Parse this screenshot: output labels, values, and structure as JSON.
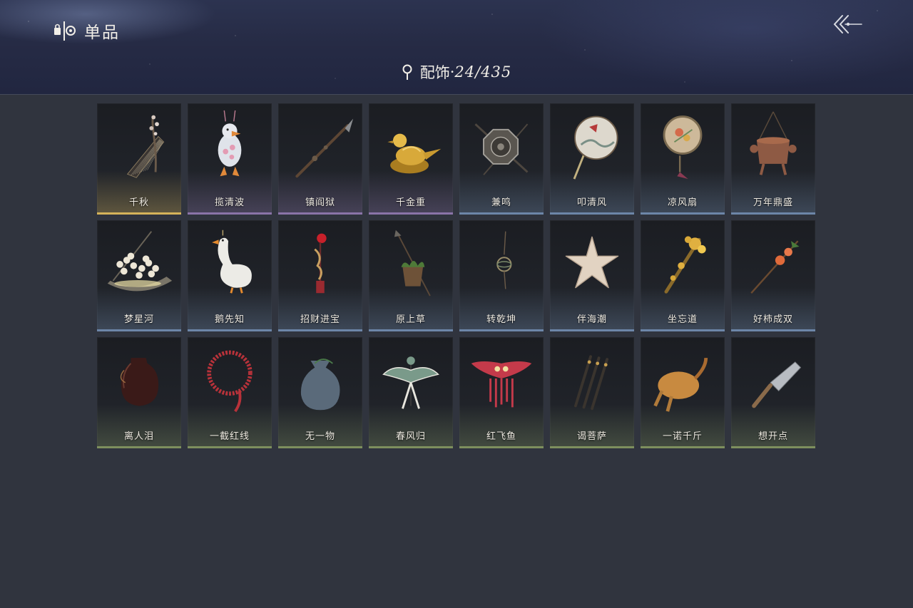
{
  "header": {
    "title": "单品",
    "back_icon": "double-chevron-left-icon"
  },
  "category": {
    "name": "配饰",
    "separator": "·",
    "count": "24/435"
  },
  "colors": {
    "gold": "#d4b25a",
    "purple": "#8a74a8",
    "blue": "#6d86a8",
    "green": "#7e8f5e"
  },
  "items": [
    {
      "name": "千秋",
      "rarity": "gold",
      "icon": "guqin-zither-icon"
    },
    {
      "name": "揽清波",
      "rarity": "purple",
      "icon": "duck-toy-icon"
    },
    {
      "name": "镇阎狱",
      "rarity": "purple",
      "icon": "spear-icon"
    },
    {
      "name": "千金重",
      "rarity": "purple",
      "icon": "golden-pheasant-icon"
    },
    {
      "name": "兼鸣",
      "rarity": "blue",
      "icon": "octagonal-shield-icon"
    },
    {
      "name": "叩清风",
      "rarity": "blue",
      "icon": "round-fan-icon"
    },
    {
      "name": "凉风扇",
      "rarity": "blue",
      "icon": "embroidered-fan-icon"
    },
    {
      "name": "万年鼎盛",
      "rarity": "blue",
      "icon": "tripod-censer-icon"
    },
    {
      "name": "梦星河",
      "rarity": "blue",
      "icon": "flower-basket-icon"
    },
    {
      "name": "鹅先知",
      "rarity": "blue",
      "icon": "goose-icon"
    },
    {
      "name": "招财进宝",
      "rarity": "blue",
      "icon": "tassel-pendant-icon"
    },
    {
      "name": "原上草",
      "rarity": "blue",
      "icon": "herb-basket-icon"
    },
    {
      "name": "转乾坤",
      "rarity": "blue",
      "icon": "armillary-charm-icon"
    },
    {
      "name": "伴海潮",
      "rarity": "blue",
      "icon": "starfish-icon"
    },
    {
      "name": "坐忘道",
      "rarity": "blue",
      "icon": "golden-scepter-icon"
    },
    {
      "name": "好柿成双",
      "rarity": "blue",
      "icon": "persimmon-branch-icon"
    },
    {
      "name": "离人泪",
      "rarity": "green",
      "icon": "wine-jar-icon"
    },
    {
      "name": "一截红线",
      "rarity": "green",
      "icon": "red-cord-icon"
    },
    {
      "name": "无一物",
      "rarity": "green",
      "icon": "cloth-pouch-icon"
    },
    {
      "name": "春风归",
      "rarity": "green",
      "icon": "swallow-kite-icon"
    },
    {
      "name": "红飞鱼",
      "rarity": "green",
      "icon": "fish-kite-icon"
    },
    {
      "name": "谒菩萨",
      "rarity": "green",
      "icon": "triple-dagger-icon"
    },
    {
      "name": "一诺千斤",
      "rarity": "green",
      "icon": "roast-chicken-icon"
    },
    {
      "name": "想开点",
      "rarity": "green",
      "icon": "cleaver-icon"
    }
  ]
}
